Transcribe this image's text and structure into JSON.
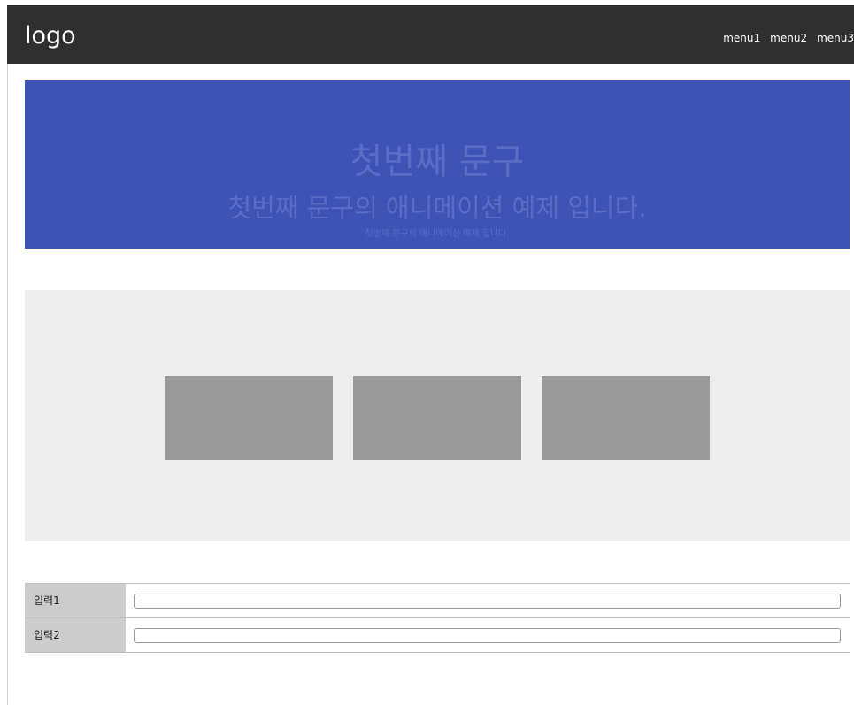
{
  "header": {
    "logo": "logo",
    "menu": [
      "menu1",
      "menu2",
      "menu3"
    ]
  },
  "hero": {
    "title": "첫번째 문구",
    "subtitle": "첫번째 문구의 애니메이션 예제 입니다.",
    "caption": "첫번째 문구의 애니메이션 예제 입니다."
  },
  "cards": {
    "count": 3
  },
  "form": {
    "rows": [
      {
        "label": "입력1",
        "value": "",
        "placeholder": ""
      },
      {
        "label": "입력2",
        "value": "",
        "placeholder": ""
      }
    ]
  },
  "colors": {
    "header_bg": "#2f2f2f",
    "hero_bg": "#3e53b5",
    "hero_text": "#596cc6",
    "section_bg": "#eeeeee",
    "card_bg": "#999999",
    "label_bg": "#cccccc"
  }
}
